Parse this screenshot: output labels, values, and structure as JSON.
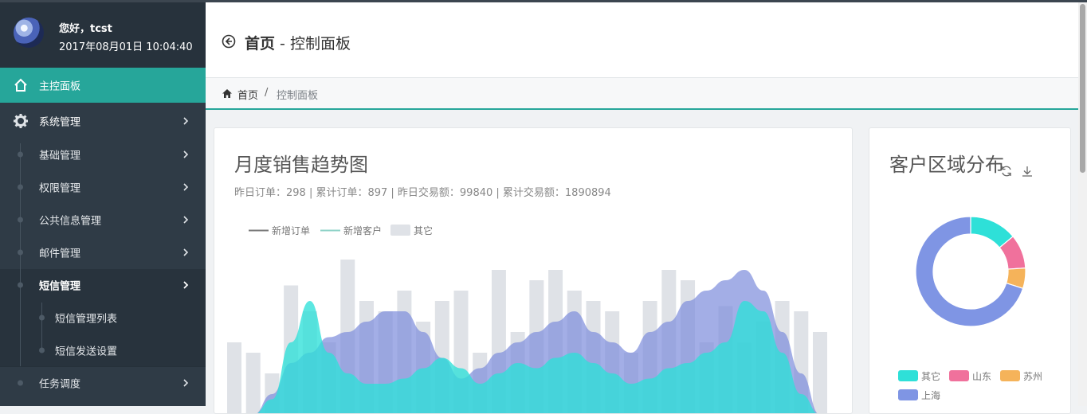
{
  "user": {
    "greeting": "您好，tcst",
    "datetime": "2017年08月01日 10:04:40"
  },
  "sidebar": {
    "items": [
      {
        "label": "主控面板",
        "icon": "home-icon",
        "active": true
      },
      {
        "label": "系统管理",
        "icon": "gear-icon"
      },
      {
        "label": "基础管理"
      },
      {
        "label": "权限管理"
      },
      {
        "label": "公共信息管理"
      },
      {
        "label": "邮件管理"
      },
      {
        "label": "短信管理",
        "expanded": true
      },
      {
        "label": "短信管理列表",
        "sub": true
      },
      {
        "label": "短信发送设置",
        "sub": true
      },
      {
        "label": "任务调度"
      }
    ]
  },
  "header": {
    "title_bold": "首页",
    "title_rest": " - 控制面板",
    "back_icon": "arrow-left-circle-icon"
  },
  "breadcrumb": {
    "home": "首页",
    "separator": "/",
    "current": "控制面板"
  },
  "sales_panel": {
    "title": "月度销售趋势图",
    "subtitle": "昨日订单：298 | 累计订单：897 | 昨日交易额：99840 | 累计交易额：1890894"
  },
  "region_panel": {
    "title": "客户区域分布",
    "refresh_icon": "refresh-icon",
    "download_icon": "download-icon"
  },
  "colors": {
    "accent": "#26a69a",
    "sidebar": "#2f3b46",
    "series_order": "#7f8fdc",
    "series_customer": "#2ee0d8",
    "series_other": "#dfe2e7"
  },
  "chart_data": [
    {
      "type": "area",
      "legend": [
        "新增订单",
        "新增客户",
        "其它"
      ],
      "series": [
        {
          "name": "其它",
          "type": "bar",
          "values": [
            14,
            12,
            8,
            25,
            20,
            14,
            30,
            22,
            20,
            24,
            18,
            22,
            24,
            12,
            28,
            16,
            26,
            28,
            24,
            22,
            20,
            12,
            22,
            28,
            26,
            14,
            21,
            14,
            18,
            22,
            20,
            16
          ]
        },
        {
          "name": "新增订单",
          "type": "area",
          "values": [
            0,
            0,
            4,
            10,
            12,
            15,
            16,
            18,
            20,
            20,
            16,
            11,
            7,
            9,
            12,
            14,
            16,
            18,
            20,
            16,
            14,
            12,
            16,
            18,
            22,
            24,
            26,
            28,
            24,
            16,
            8,
            0
          ]
        },
        {
          "name": "新增客户",
          "type": "area",
          "values": [
            0,
            0,
            3,
            14,
            22,
            12,
            8,
            6,
            6,
            7,
            9,
            11,
            9,
            6,
            8,
            10,
            9,
            11,
            12,
            10,
            8,
            6,
            7,
            9,
            10,
            12,
            14,
            22,
            20,
            12,
            4,
            0
          ]
        }
      ]
    },
    {
      "type": "pie",
      "donut": true,
      "slices": [
        {
          "label": "其它",
          "value": 14,
          "color": "#2ee0d8"
        },
        {
          "label": "山东",
          "value": 10,
          "color": "#f0719c"
        },
        {
          "label": "苏州",
          "value": 6,
          "color": "#f5b35a"
        },
        {
          "label": "上海",
          "value": 70,
          "color": "#7f95e4"
        }
      ],
      "legend": [
        "其它",
        "山东",
        "苏州",
        "上海"
      ]
    }
  ]
}
